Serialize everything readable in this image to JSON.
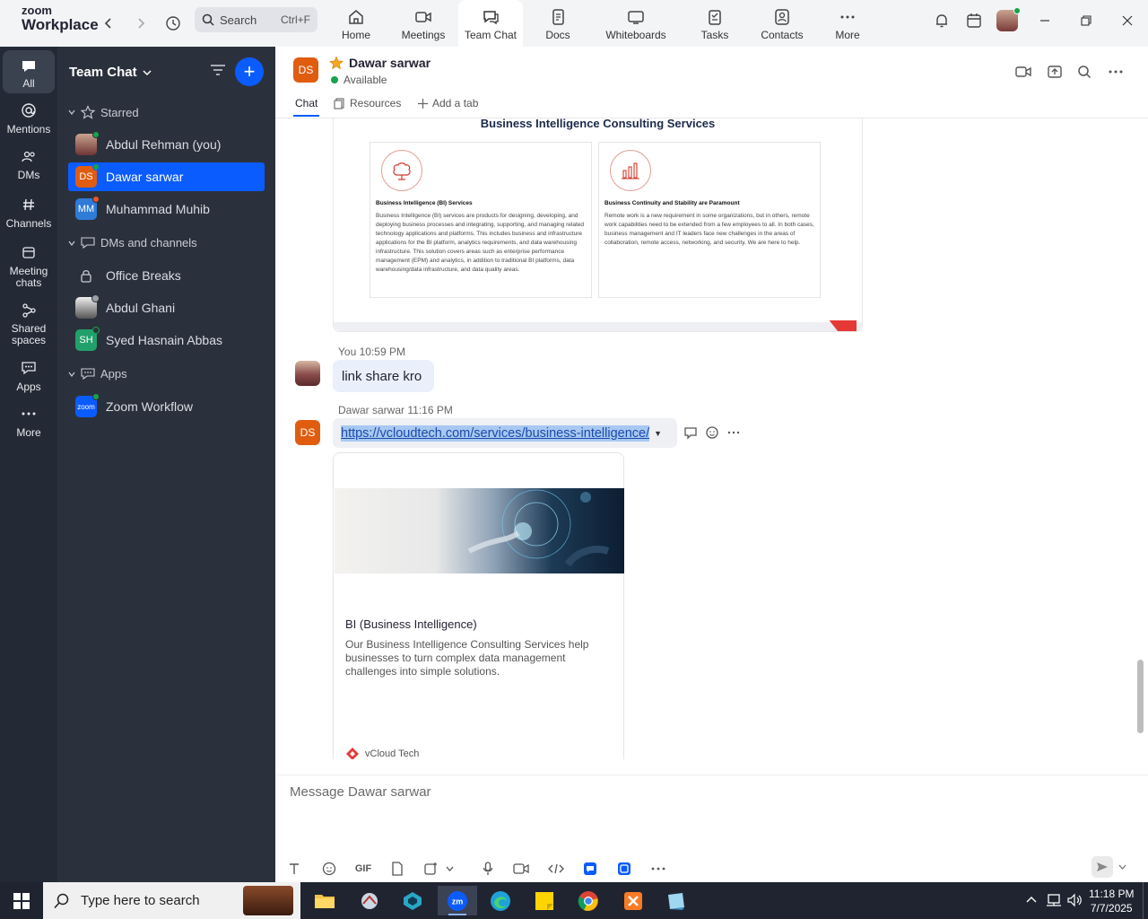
{
  "app": {
    "brand_top": "zoom",
    "brand_bottom": "Workplace"
  },
  "search": {
    "label": "Search",
    "shortcut": "Ctrl+F"
  },
  "top_tabs": [
    {
      "label": "Home",
      "icon": "home-icon"
    },
    {
      "label": "Meetings",
      "icon": "video-camera-icon"
    },
    {
      "label": "Team Chat",
      "icon": "chat-bubble-icon",
      "active": true
    },
    {
      "label": "Docs",
      "icon": "document-icon"
    },
    {
      "label": "Whiteboards",
      "icon": "whiteboard-icon"
    },
    {
      "label": "Tasks",
      "icon": "tasks-icon"
    },
    {
      "label": "Contacts",
      "icon": "contacts-icon"
    },
    {
      "label": "More",
      "icon": "more-dots-icon"
    }
  ],
  "rail": [
    {
      "label": "All",
      "icon": "chat-icon",
      "active": true
    },
    {
      "label": "Mentions",
      "icon": "at-icon"
    },
    {
      "label": "DMs",
      "icon": "people-icon"
    },
    {
      "label": "Channels",
      "icon": "hash-icon"
    },
    {
      "label": "Meeting chats",
      "icon": "calendar-icon"
    },
    {
      "label": "Shared spaces",
      "icon": "shared-icon"
    },
    {
      "label": "Apps",
      "icon": "apps-icon"
    },
    {
      "label": "More",
      "icon": "more-icon"
    }
  ],
  "sidebar": {
    "title": "Team Chat",
    "starred": {
      "label": "Starred",
      "items": [
        {
          "label": "Abdul Rehman (you)",
          "initials": "",
          "color": "#7a4a3a",
          "status": "#16a34a"
        },
        {
          "label": "Dawar sarwar",
          "initials": "DS",
          "color": "#e05d10",
          "status": "#16a34a",
          "selected": true
        },
        {
          "label": "Muhammad Muhib",
          "initials": "MM",
          "color": "#2f7bd8",
          "status": "#e8562a"
        }
      ]
    },
    "dms": {
      "label": "DMs and channels",
      "items": [
        {
          "label": "Office Breaks",
          "type": "lock"
        },
        {
          "label": "Abdul Ghani",
          "type": "photo"
        },
        {
          "label": "Syed Hasnain Abbas",
          "initials": "SH",
          "color": "#22a06b"
        }
      ]
    },
    "apps": {
      "label": "Apps",
      "items": [
        {
          "label": "Zoom Workflow",
          "initials": "zoom",
          "color": "#0b5cff"
        }
      ]
    }
  },
  "chat": {
    "name": "Dawar sarwar",
    "initials": "DS",
    "status": "Available",
    "tabs": [
      "Chat",
      "Resources",
      "Add a tab"
    ]
  },
  "page_card": {
    "title": "Business Intelligence Consulting Services",
    "left": {
      "heading": "Business Intelligence (BI) Services",
      "text": "Business Intelligence (BI) services are products for designing, developing, and deploying business processes and integrating, supporting, and managing related technology applications and platforms. This includes business and infrastructure applications for the BI platform, analytics requirements, and data warehousing infrastructure. This solution covers areas such as enterprise performance management (EPM) and analytics, in addition to traditional BI platforms, data warehousing/data infrastructure, and data quality areas."
    },
    "right": {
      "heading": "Business Continuity and Stability are Paramount",
      "text": "Remote work is a new requirement in some organizations, but in others, remote work capabilities need to be extended from a few employees to all. In both cases, business management and IT leaders face new challenges in the areas of collaboration, remote access, networking, and security. We are here to help."
    }
  },
  "messages": [
    {
      "sender": "You",
      "time": "10:59 PM",
      "text": "link share kro"
    },
    {
      "sender": "Dawar sarwar",
      "time": "11:16 PM",
      "initials": "DS",
      "link": "https://vcloudtech.com/services/business-intelligence/"
    }
  ],
  "preview": {
    "title": "BI  (Business Intelligence)",
    "description": "Our Business Intelligence Consulting Services help businesses to turn complex data management challenges into simple solutions.",
    "site": "vCloud Tech"
  },
  "composer": {
    "placeholder": "Message Dawar sarwar",
    "gif": "GIF"
  },
  "taskbar": {
    "search_placeholder": "Type here to search",
    "time": "11:18 PM",
    "date": "7/7/2025"
  },
  "colors": {
    "accent": "#0b5cff",
    "sidebar": "#2b313c",
    "rail": "#232a36",
    "online": "#16a34a"
  }
}
